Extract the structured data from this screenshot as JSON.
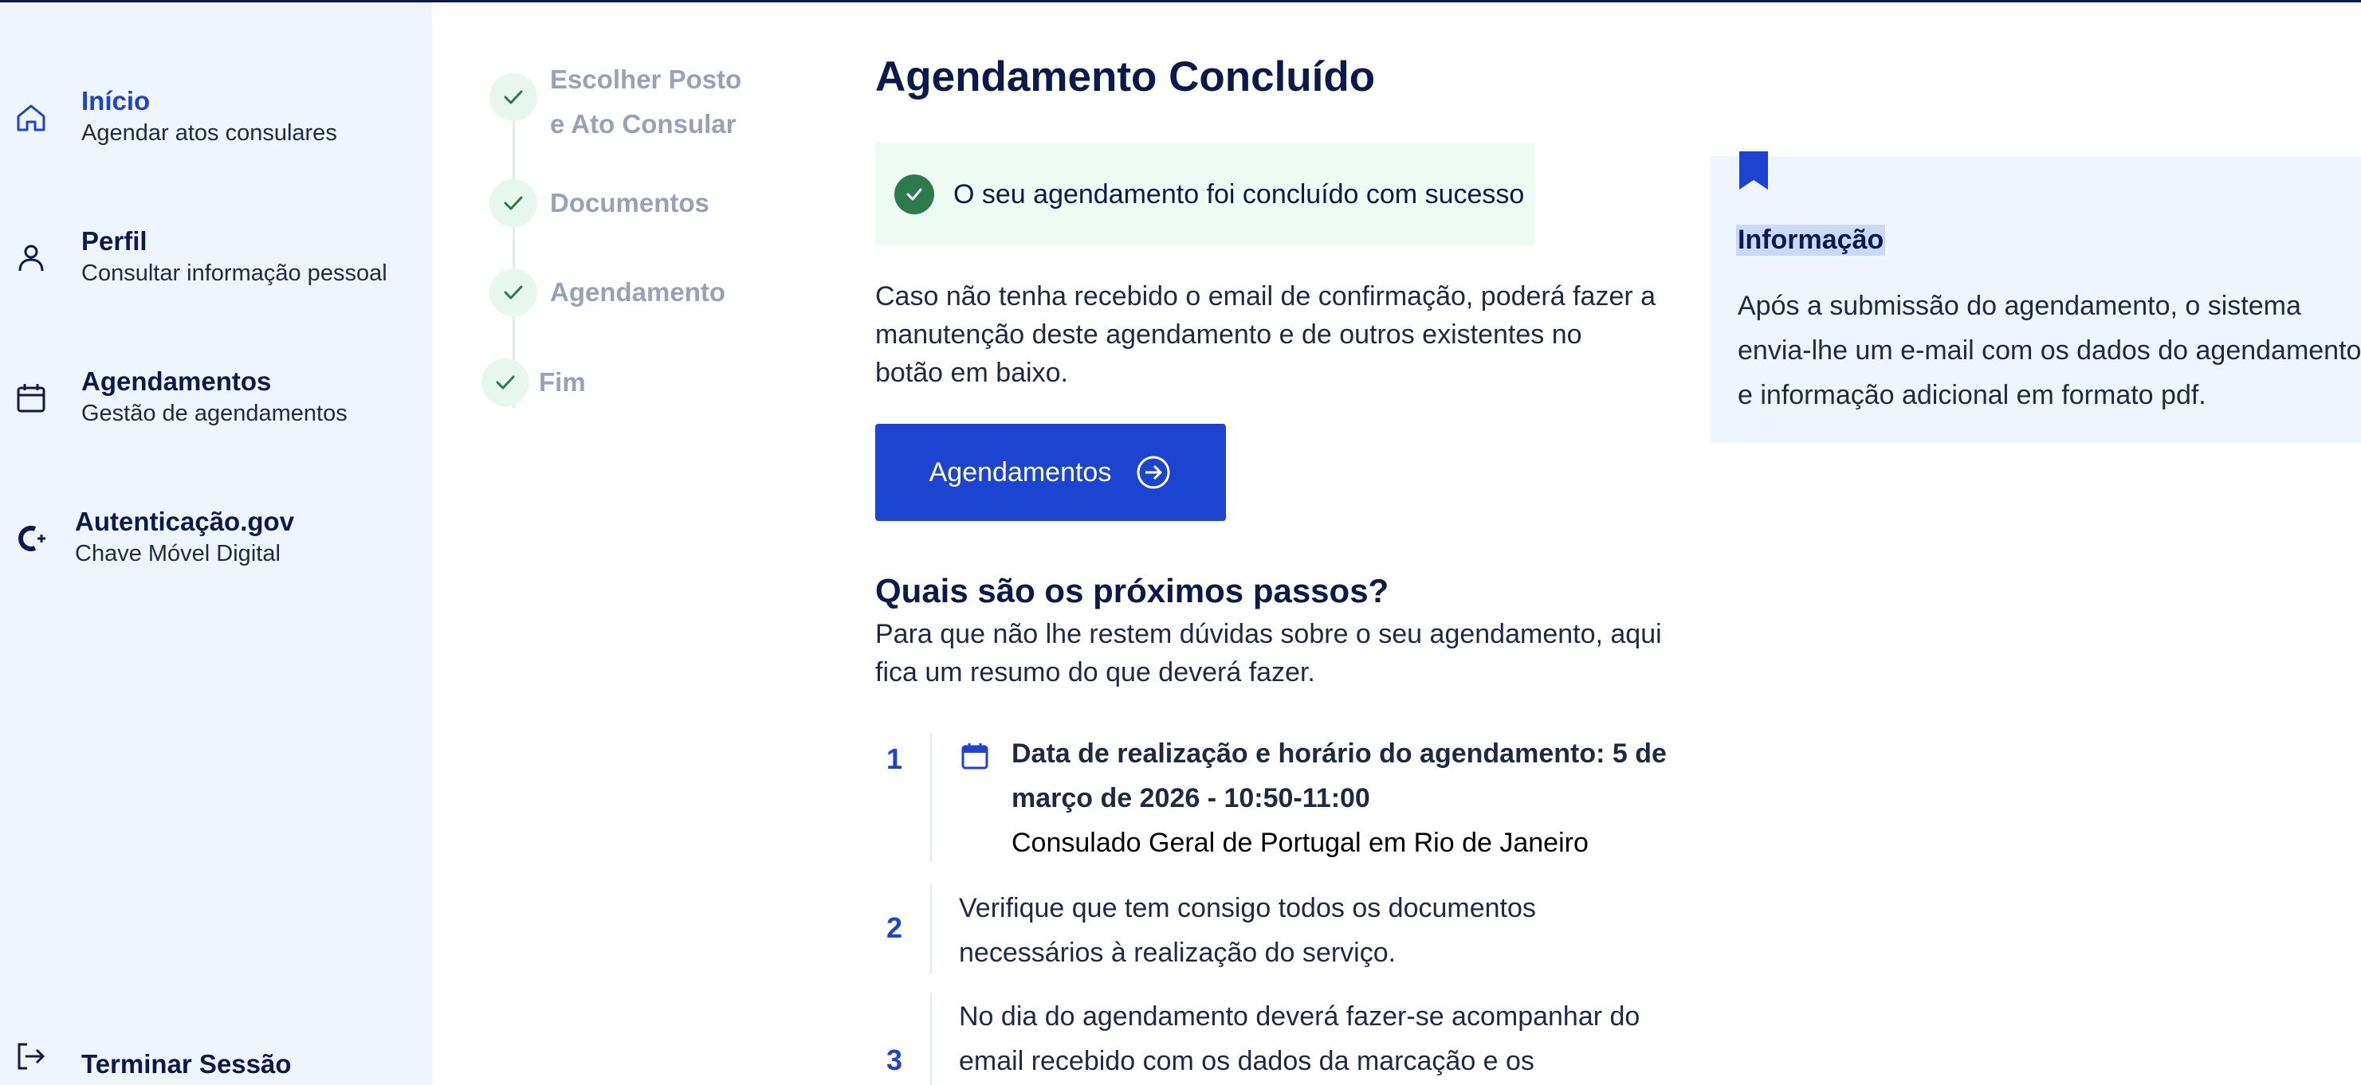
{
  "sidebar": {
    "items": [
      {
        "title": "Início",
        "subtitle": "Agendar atos consulares",
        "icon": "home-icon"
      },
      {
        "title": "Perfil",
        "subtitle": "Consultar informação pessoal",
        "icon": "user-icon"
      },
      {
        "title": "Agendamentos",
        "subtitle": "Gestão de agendamentos",
        "icon": "calendar-icon"
      },
      {
        "title": "Autenticação.gov",
        "subtitle": "Chave Móvel Digital",
        "icon": "autenticacao-gov-icon"
      }
    ],
    "logout": "Terminar Sessão"
  },
  "stepper": {
    "steps": [
      {
        "label_line1": "Escolher Posto",
        "label_line2": "e Ato Consular"
      },
      {
        "label": "Documentos"
      },
      {
        "label": "Agendamento"
      },
      {
        "label": "Fim"
      }
    ]
  },
  "main": {
    "title": "Agendamento Concluído",
    "success_message": "O seu agendamento foi concluído com sucesso",
    "paragraph_lines": [
      "Caso não tenha recebido o email de confirmação, poderá fazer a",
      "manutenção deste agendamento e de outros existentes no",
      "botão em baixo."
    ],
    "button_label": "Agendamentos",
    "next_steps_heading": "Quais são os próximos passos?",
    "next_steps_intro_lines": [
      "Para que não lhe restem dúvidas sobre o seu agendamento, aqui",
      "fica um resumo do que deverá fazer."
    ],
    "steps": [
      {
        "number": "1",
        "line1": "Data de realização e horário do agendamento: 5 de",
        "line2": "março de 2026  - 10:50-11:00",
        "line3": "Consulado Geral de Portugal em Rio de Janeiro"
      },
      {
        "number": "2",
        "line1": "Verifique que tem consigo todos os documentos",
        "line2": "necessários à realização do serviço."
      },
      {
        "number": "3",
        "line1": "No dia do agendamento deverá fazer-se acompanhar do",
        "line2": "email recebido com os dados da marcação e os"
      }
    ]
  },
  "info": {
    "title": "Informação",
    "text_lines": [
      "Após a submissão do agendamento, o sistema",
      "envia-lhe um e-mail com os dados do agendamento",
      "e informação adicional em formato pdf."
    ]
  },
  "colors": {
    "accent": "#1d44d0",
    "navy": "#0b1a4a",
    "sidebar_bg": "#eef5ff",
    "success_bg": "#edfbf2",
    "success_icon": "#2d7a4f",
    "step_muted": "#98a2b6"
  }
}
